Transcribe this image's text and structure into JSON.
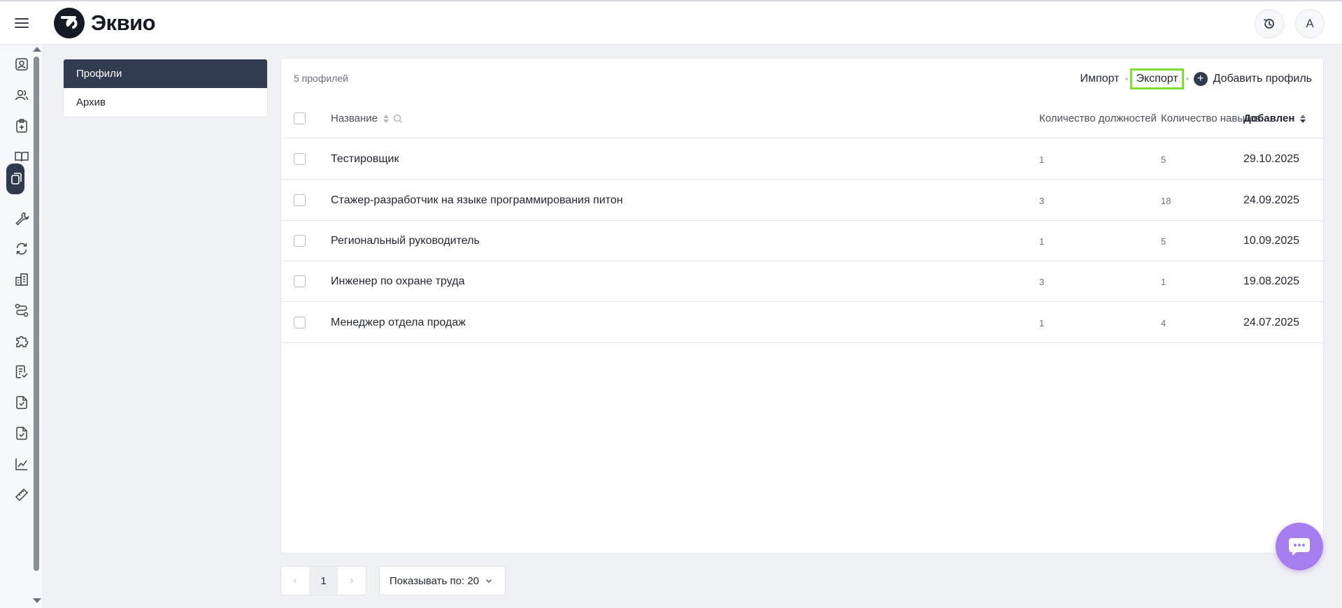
{
  "app": {
    "name": "Эквио"
  },
  "header": {
    "avatar_letter": "А"
  },
  "rail": {
    "icons": [
      "profile-card-icon",
      "users-icon",
      "clipboard-plus-icon",
      "book-icon",
      "profiles-icon",
      "wrench-icon",
      "refresh-icon",
      "building-icon",
      "route-icon",
      "puzzle-icon",
      "checklist-icon",
      "file-check-icon",
      "file-check-2-icon",
      "chart-line-icon",
      "ruler-icon"
    ],
    "active": "profiles-icon"
  },
  "sidemenu": {
    "items": [
      {
        "label": "Профили",
        "active": true
      },
      {
        "label": "Архив",
        "active": false
      }
    ]
  },
  "toolbar": {
    "count_text": "5 профилей",
    "import_label": "Импорт",
    "export_label": "Экспорт",
    "add_label": "Добавить профиль"
  },
  "table": {
    "columns": {
      "name": "Название",
      "positions": "Количество должностей",
      "skills": "Количество навыков",
      "added": "Добавлен"
    },
    "rows": [
      {
        "name": "Тестировщик",
        "positions": "1",
        "skills": "5",
        "added": "29.10.2025"
      },
      {
        "name": "Стажер-разработчик на языке программирования питон",
        "positions": "3",
        "skills": "18",
        "added": "24.09.2025"
      },
      {
        "name": "Региональный руководитель",
        "positions": "1",
        "skills": "5",
        "added": "10.09.2025"
      },
      {
        "name": "Инженер по охране труда",
        "positions": "3",
        "skills": "1",
        "added": "19.08.2025"
      },
      {
        "name": "Менеджер отдела продаж",
        "positions": "1",
        "skills": "4",
        "added": "24.07.2025"
      }
    ]
  },
  "pagination": {
    "current_page": "1",
    "prev_symbol": "‹",
    "next_symbol": "›",
    "per_page_label": "Показывать по: 20"
  },
  "colors": {
    "active_nav": "#323c50",
    "export_highlight": "#7ee02e",
    "chat_button": "#a77ef0"
  }
}
